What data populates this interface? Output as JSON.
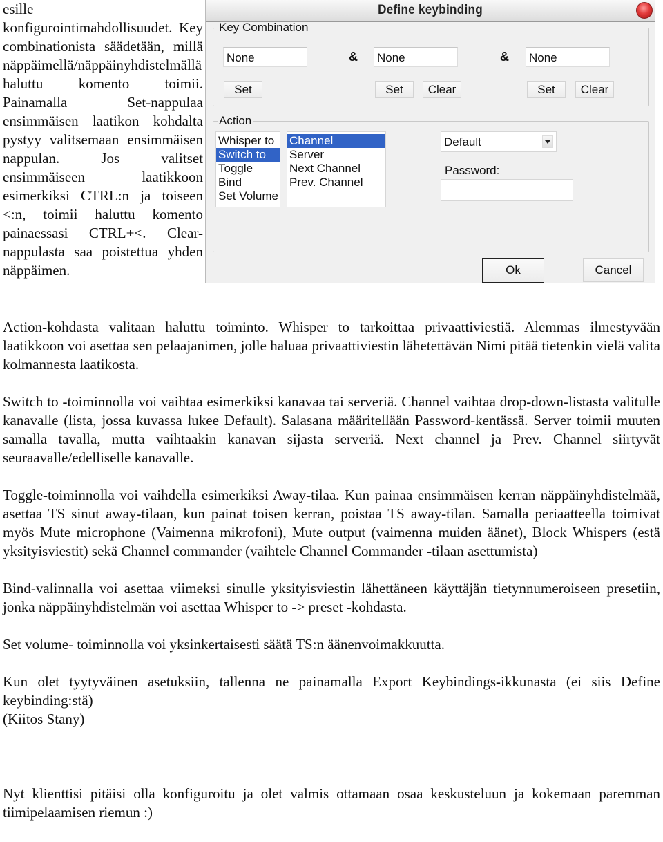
{
  "side_paragraph": "esille konfigurointimahdollisuudet. Key combinationista säädetään, millä näppäimellä/näppäinyhdistelmällä haluttu komento toimii. Painamalla Set-nappulaa ensimmäisen laatikon kohdalta pystyy valitsemaan ensimmäisen nappulan. Jos valitset ensimmäiseen laatikkoon esimerkiksi CTRL:n ja toiseen <:n, toimii haluttu komento painaessasi CTRL+<. Clear-nappulasta saa poistettua yhden näppäimen.",
  "side_lines": [
    "esille konfigurointimahdolli-",
    "suudet. Key combinationista",
    "säädetään, millä",
    "näppäimellä/näppäin-",
    "yhdistelmällä haluttu komento",
    "toimii. Painamalla Set-",
    "nappulaa ensimmäisen",
    "laatikon kohdalta pystyy",
    "valitsemaan ensimmäisen",
    "nappulan. Jos valitset",
    "ensimmäiseen laatikkoon",
    "esimerkiksi CTRL:n ja toiseen",
    "<:n, toimii haluttu komento",
    "painaessasi CTRL+<. Clear-",
    "nappulasta saa poistettua",
    "yhden näppäimen."
  ],
  "dialog": {
    "title": "Define keybinding",
    "key_combination": {
      "legend": "Key Combination",
      "fields": [
        "None",
        "None",
        "None"
      ],
      "separator": "&",
      "set_label": "Set",
      "clear_label": "Clear"
    },
    "action": {
      "legend": "Action",
      "actions": [
        "Whisper to",
        "Switch to",
        "Toggle",
        "Bind",
        "Set Volume"
      ],
      "selected_action": "Switch to",
      "targets": [
        "Channel",
        "Server",
        "Next Channel",
        "Prev. Channel"
      ],
      "selected_target": "Channel",
      "channel_dropdown_value": "Default",
      "password_label": "Password:",
      "password_value": ""
    },
    "ok_label": "Ok",
    "cancel_label": "Cancel",
    "selection_color": "#3163c6",
    "close_button_color": "#e23b3b"
  },
  "paragraphs": [
    "Action-kohdasta valitaan haluttu toiminto. Whisper to tarkoittaa privaattiviestiä. Alemmas ilmestyvään laatikkoon voi asettaa sen pelaajanimen, jolle haluaa privaattiviestin lähetettävän Nimi pitää tietenkin vielä valita kolmannesta laatikosta.",
    "Switch to -toiminnolla voi vaihtaa esimerkiksi kanavaa tai serveriä. Channel vaihtaa drop-down-listasta valitulle kanavalle (lista, jossa kuvassa lukee Default). Salasana määritellään Password-kentässä. Server toimii muuten samalla tavalla, mutta vaihtaakin kanavan sijasta serveriä. Next channel ja Prev. Channel siirtyvät seuraavalle/edelliselle kanavalle.",
    "Toggle-toiminnolla voi vaihdella esimerkiksi Away-tilaa. Kun painaa ensimmäisen kerran näppäinyhdistelmää, asettaa TS sinut away-tilaan, kun painat toisen kerran, poistaa TS away-tilan. Samalla periaatteella toimivat myös Mute microphone (Vaimenna mikrofoni), Mute output (vaimenna muiden äänet),  Block Whispers (estä yksityisviestit) sekä Channel commander (vaihtele Channel Commander -tilaan asettumista)",
    "Bind-valinnalla voi asettaa viimeksi sinulle yksityisviestin lähettäneen käyttäjän tietynnumeroiseen presetiin, jonka näppäinyhdistelmän voi asettaa Whisper to -> preset -kohdasta.",
    "Set volume- toiminnolla voi yksinkertaisesti säätä TS:n äänenvoimakkuutta.",
    "Kun olet tyytyväinen asetuksiin, tallenna ne painamalla Export Keybindings-ikkunasta (ei siis Define keybinding:stä)",
    "(Kiitos Stany)",
    "Nyt klienttisi pitäisi olla konfiguroitu ja olet valmis ottamaan osaa keskusteluun ja kokemaan paremman tiimipelaamisen riemun :)"
  ]
}
